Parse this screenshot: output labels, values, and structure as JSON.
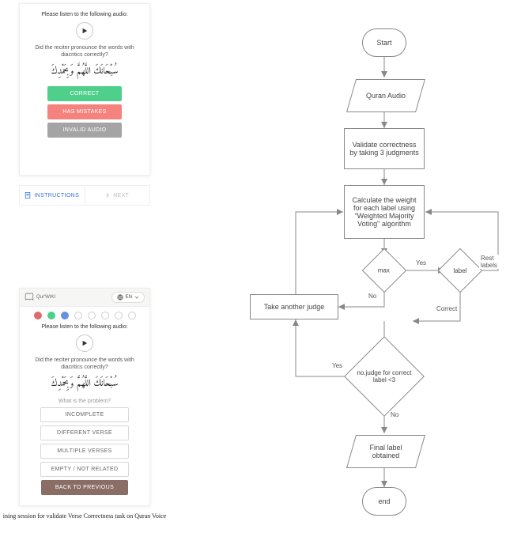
{
  "card1": {
    "prompt": "Please listen to the following audio:",
    "question": "Did the reciter pronounce the words with diacritics correctly?",
    "arabic": "سُبْحَانَكَ اللَّهُمَّ وَبِحَمْدِكَ",
    "correct": "CORRECT",
    "mistakes": "HAS MISTAKES",
    "invalid": "INVALID AUDIO"
  },
  "tabs": {
    "instructions": "INSTRUCTIONS",
    "next": "NEXT"
  },
  "card2": {
    "brand": "Qur'WIKI",
    "lang": "EN",
    "prompt": "Please listen to the following audio:",
    "question": "Did the reciter pronounce the words with diacritics correctly?",
    "arabic": "سُبْحَانَكَ اللَّهُمَّ وَبِحَمْدِكَ",
    "subq": "What is the problem?",
    "opt_incomplete": "INCOMPLETE",
    "opt_different": "DIFFERENT VERSE",
    "opt_multiple": "MULTIPLE VERSES",
    "opt_empty": "EMPTY / NOT RELATED",
    "back": "BACK TO PREVIOUS"
  },
  "caption": "ining session for validate Verse Correctness task on Quran Voice",
  "flow": {
    "start": "Start",
    "audio": "Quran Audio",
    "validate": "Validate correctness by taking 3 judgments",
    "weight": "Calculate the weight for each label using \"Weighted Majority Voting\" algorithm",
    "max": "max",
    "label": "label",
    "take": "Take another judge",
    "cond": "no.judge for correct label <3",
    "final": "Final label obtained",
    "end": "end",
    "yes": "Yes",
    "no": "No",
    "correct": "Correct",
    "rest": "Rest labels"
  }
}
